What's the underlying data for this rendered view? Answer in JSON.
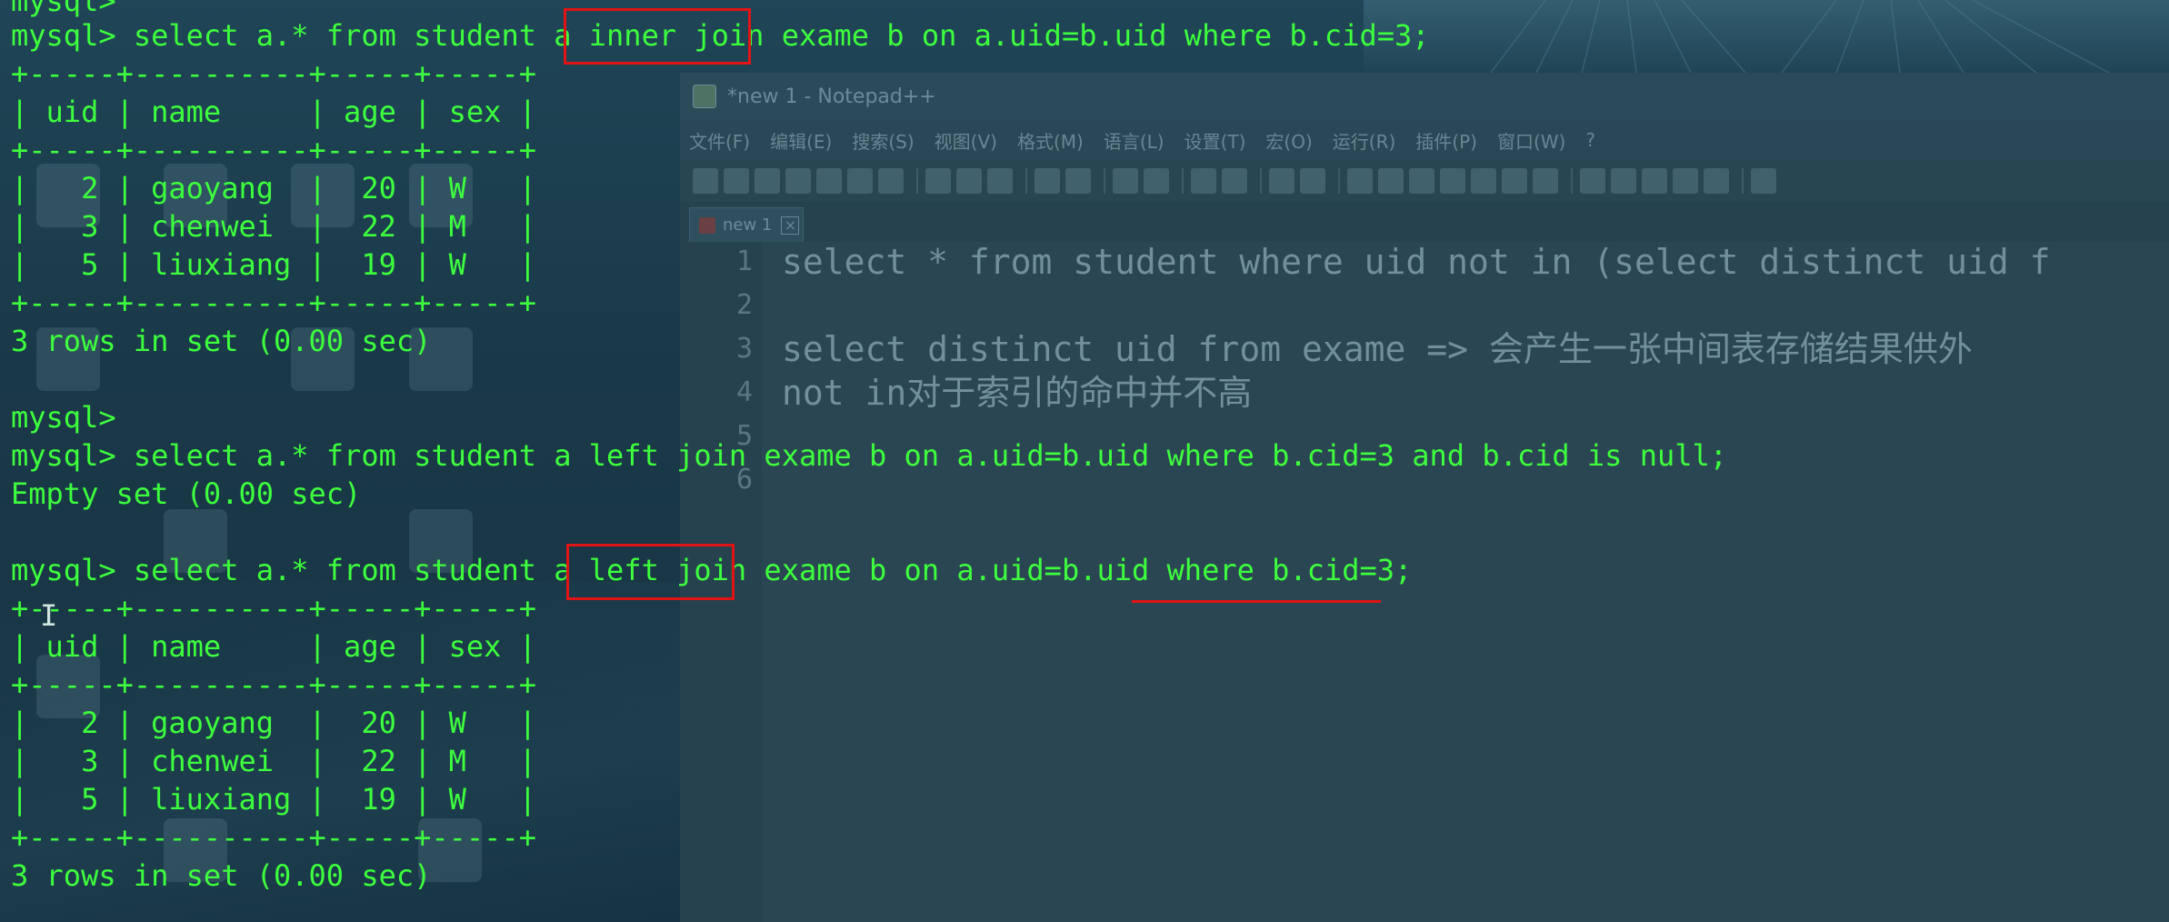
{
  "notepad": {
    "title": "*new 1 - Notepad++",
    "menu": [
      "文件(F)",
      "编辑(E)",
      "搜索(S)",
      "视图(V)",
      "格式(M)",
      "语言(L)",
      "设置(T)",
      "宏(O)",
      "运行(R)",
      "插件(P)",
      "窗口(W)",
      "?"
    ],
    "tab_label": "new 1",
    "lines": [
      {
        "num": "1",
        "text": "select * from student where uid not in (select distinct uid f"
      },
      {
        "num": "2",
        "text": ""
      },
      {
        "num": "3",
        "text": "select distinct uid from exame => 会产生一张中间表存储结果供外"
      },
      {
        "num": "4",
        "text": "not in对于索引的命中并不高"
      },
      {
        "num": "5",
        "text": ""
      },
      {
        "num": "6",
        "text": ""
      }
    ]
  },
  "terminal": {
    "lines": [
      "mysql>",
      "mysql> select a.* from student a inner join exame b on a.uid=b.uid where b.cid=3;",
      "+-----+----------+-----+-----+",
      "| uid | name     | age | sex |",
      "+-----+----------+-----+-----+",
      "|   2 | gaoyang  |  20 | W   |",
      "|   3 | chenwei  |  22 | M   |",
      "|   5 | liuxiang |  19 | W   |",
      "+-----+----------+-----+-----+",
      "3 rows in set (0.00 sec)",
      "",
      "mysql>",
      "mysql> select a.* from student a left join exame b on a.uid=b.uid where b.cid=3 and b.cid is null;",
      "Empty set (0.00 sec)",
      "",
      "mysql> select a.* from student a left join exame b on a.uid=b.uid where b.cid=3;",
      "+-----+----------+-----+-----+",
      "| uid | name     | age | sex |",
      "+-----+----------+-----+-----+",
      "|   2 | gaoyang  |  20 | W   |",
      "|   3 | chenwei  |  22 | M   |",
      "|   5 | liuxiang |  19 | W   |",
      "+-----+----------+-----+-----+",
      "3 rows in set (0.00 sec)"
    ]
  },
  "colors": {
    "terminal_text": "#3dff3d",
    "highlight": "#e01414",
    "background": "#1d3d4c"
  }
}
